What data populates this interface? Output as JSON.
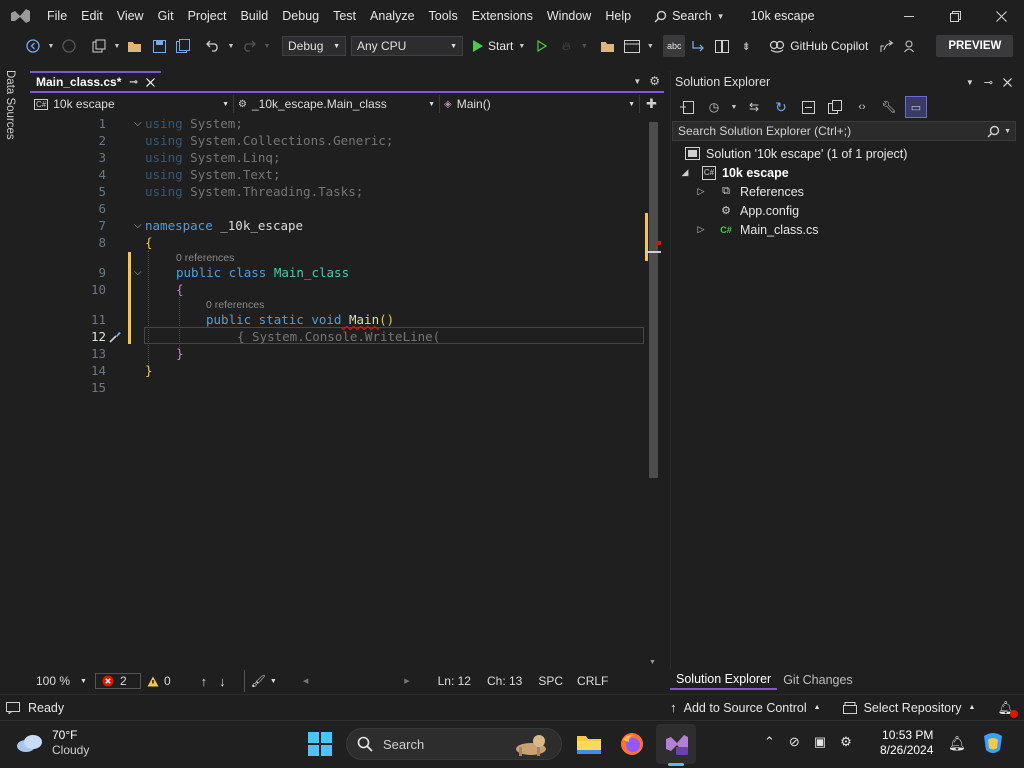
{
  "titlebar": {
    "menu": [
      "File",
      "Edit",
      "View",
      "Git",
      "Project",
      "Build",
      "Debug",
      "Test",
      "Analyze",
      "Tools",
      "Extensions",
      "Window",
      "Help"
    ],
    "search_label": "Search",
    "solution_name": "10k escape"
  },
  "toolbar": {
    "config": "Debug",
    "platform": "Any CPU",
    "start_label": "Start",
    "copilot_label": "GitHub Copilot",
    "preview_label": "PREVIEW"
  },
  "left_strip": {
    "data_sources": "Data Sources"
  },
  "editor": {
    "tab_label": "Main_class.cs*",
    "nav_project": "10k escape",
    "nav_class": "_10k_escape.Main_class",
    "nav_member": "Main()",
    "line_numbers": [
      "1",
      "2",
      "3",
      "4",
      "5",
      "6",
      "7",
      "8",
      "9",
      "10",
      "11",
      "12",
      "13",
      "14",
      "15"
    ],
    "lines": {
      "l1_kw": "using",
      "l1_rest": " System;",
      "l2_kw": "using",
      "l2_rest": " System.Collections.Generic;",
      "l3_kw": "using",
      "l3_rest": " System.Linq;",
      "l4_kw": "using",
      "l4_rest": " System.Text;",
      "l5_kw": "using",
      "l5_rest": " System.Threading.Tasks;",
      "l7_kw": "namespace",
      "l7_rest": " _10k_escape",
      "l8": "{",
      "lens_9": "0 references",
      "l9_kw": "public class",
      "l9_type": " Main_class",
      "l10": "{",
      "lens_11": "0 references",
      "l11_kw": "public static void",
      "l11_fn": " Main",
      "l11_rest": "()",
      "l12": "{ System.Console.WriteLine(",
      "l13": "}",
      "l14": "}"
    },
    "status": {
      "zoom": "100 %",
      "errors": "2",
      "warnings": "0",
      "line": "Ln: 12",
      "col": "Ch: 13",
      "spacing": "SPC",
      "eol": "CRLF"
    }
  },
  "solution_explorer": {
    "title": "Solution Explorer",
    "search_placeholder": "Search Solution Explorer (Ctrl+;)",
    "solution_label": "Solution '10k escape' (1 of 1 project)",
    "project_label": "10k escape",
    "items": [
      "References",
      "App.config",
      "Main_class.cs"
    ],
    "tabs": [
      "Solution Explorer",
      "Git Changes"
    ]
  },
  "statusbar": {
    "ready": "Ready",
    "add_source": "Add to Source Control",
    "select_repo": "Select Repository"
  },
  "taskbar": {
    "temperature": "70°F",
    "weather": "Cloudy",
    "search_label": "Search",
    "time": "10:53 PM",
    "date": "8/26/2024"
  },
  "colors": {
    "accent": "#7f57d8",
    "keyword": "#569cd6",
    "type": "#4ec9b0",
    "method": "#dcdcaa",
    "error": "#e51400",
    "warning": "#f2c94c"
  }
}
